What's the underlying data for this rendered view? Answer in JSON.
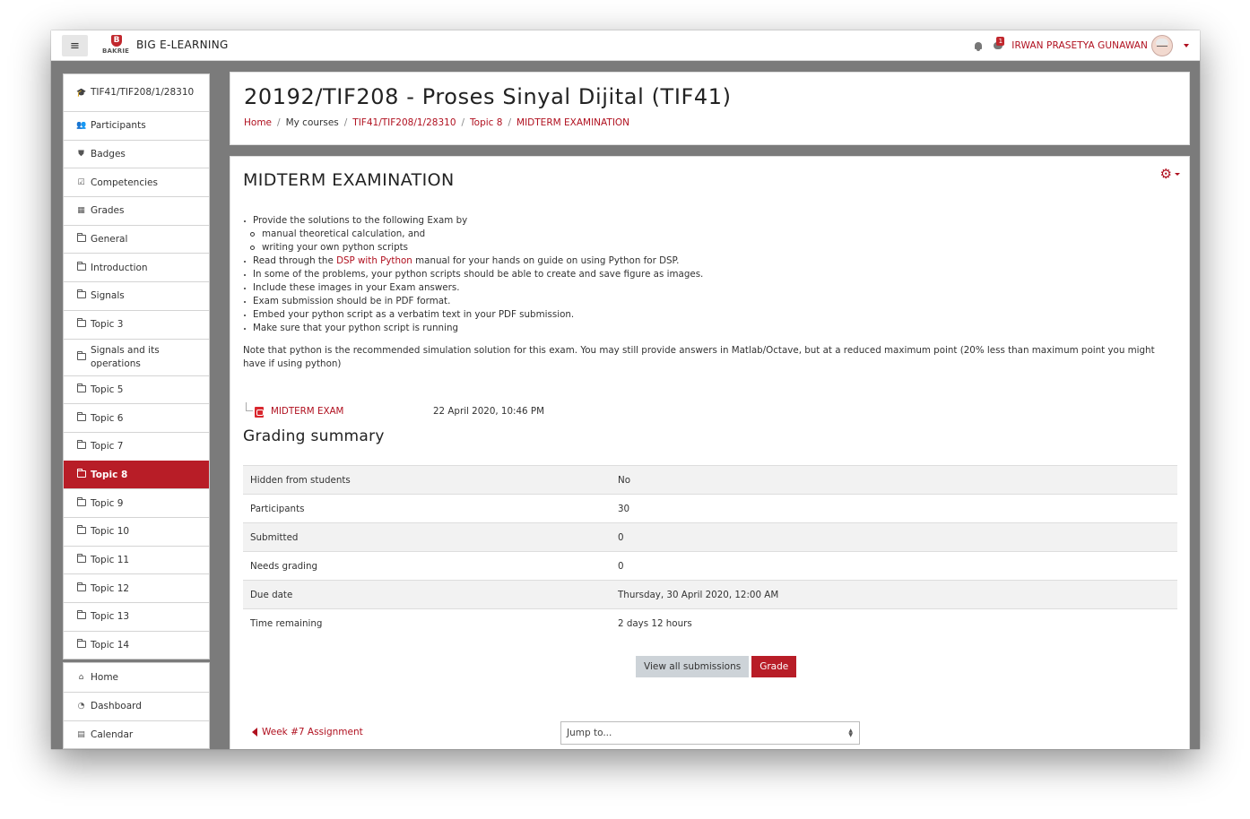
{
  "navbar": {
    "menu_icon": "hamburger-icon",
    "logo_letter": "B",
    "logo_text": "BAKRIE",
    "site_name": "BIG E-LEARNING",
    "notification_icon": "bell-icon",
    "message_icon": "chat-icon",
    "message_count": "1",
    "user_name": "IRWAN PRASETYA GUNAWAN"
  },
  "sidebar": {
    "course_nav": [
      {
        "label": "TIF41/TIF208/1/28310",
        "icon": "graduation-cap-icon"
      },
      {
        "label": "Participants",
        "icon": "users-icon"
      },
      {
        "label": "Badges",
        "icon": "shield-icon"
      },
      {
        "label": "Competencies",
        "icon": "check-square-icon"
      },
      {
        "label": "Grades",
        "icon": "table-icon"
      },
      {
        "label": "General",
        "icon": "folder-icon"
      },
      {
        "label": "Introduction",
        "icon": "folder-icon"
      },
      {
        "label": "Signals",
        "icon": "folder-icon"
      },
      {
        "label": "Topic 3",
        "icon": "folder-icon"
      },
      {
        "label": "Signals and its operations",
        "icon": "folder-icon"
      },
      {
        "label": "Topic 5",
        "icon": "folder-icon"
      },
      {
        "label": "Topic 6",
        "icon": "folder-icon"
      },
      {
        "label": "Topic 7",
        "icon": "folder-icon"
      },
      {
        "label": "Topic 8",
        "icon": "folder-icon",
        "active": true
      },
      {
        "label": "Topic 9",
        "icon": "folder-icon"
      },
      {
        "label": "Topic 10",
        "icon": "folder-icon"
      },
      {
        "label": "Topic 11",
        "icon": "folder-icon"
      },
      {
        "label": "Topic 12",
        "icon": "folder-icon"
      },
      {
        "label": "Topic 13",
        "icon": "folder-icon"
      },
      {
        "label": "Topic 14",
        "icon": "folder-icon"
      }
    ],
    "site_nav": [
      {
        "label": "Home",
        "icon": "home-icon"
      },
      {
        "label": "Dashboard",
        "icon": "dashboard-icon"
      },
      {
        "label": "Calendar",
        "icon": "calendar-icon"
      }
    ]
  },
  "header": {
    "course_title": "20192/TIF208 - Proses Sinyal Dijital (TIF41)",
    "breadcrumb": [
      {
        "label": "Home",
        "link": true
      },
      {
        "label": "My courses",
        "link": false
      },
      {
        "label": "TIF41/TIF208/1/28310",
        "link": true
      },
      {
        "label": "Topic 8",
        "link": true
      },
      {
        "label": "MIDTERM EXAMINATION",
        "link": true
      }
    ]
  },
  "main": {
    "title": "MIDTERM EXAMINATION",
    "settings_icon": "gear-icon",
    "instructions": {
      "item1": "Provide the solutions to the following Exam by",
      "item1_sub1": "manual theoretical calculation, and",
      "item1_sub2": "writing your own python scripts",
      "item2_pre": "Read through the ",
      "item2_link": "DSP with Python",
      "item2_post": " manual for your hands on guide on using Python for DSP.",
      "item3": "In some of the problems, your python scripts should be able to create and save figure as images.",
      "item4": "Include these images in your Exam answers.",
      "item5": "Exam submission should be in PDF format.",
      "item6": "Embed your python script as a verbatim text in your PDF submission.",
      "item7": "Make sure that your python script is running",
      "note": "Note that python is the recommended simulation solution for this exam. You may still provide answers in Matlab/Octave, but at a reduced maximum point (20% less than maximum point you might have if using python)"
    },
    "attachment": {
      "icon": "pdf-icon",
      "name": "MIDTERM EXAM",
      "date": "22 April 2020, 10:46 PM"
    },
    "grading_summary": {
      "title": "Grading summary",
      "rows": [
        {
          "label": "Hidden from students",
          "value": "No"
        },
        {
          "label": "Participants",
          "value": "30"
        },
        {
          "label": "Submitted",
          "value": "0"
        },
        {
          "label": "Needs grading",
          "value": "0"
        },
        {
          "label": "Due date",
          "value": "Thursday, 30 April 2020, 12:00 AM"
        },
        {
          "label": "Time remaining",
          "value": "2 days 12 hours"
        }
      ]
    },
    "buttons": {
      "view_all": "View all submissions",
      "grade": "Grade"
    },
    "footer_nav": {
      "prev_label": "Week #7 Assignment",
      "jump_placeholder": "Jump to..."
    }
  }
}
